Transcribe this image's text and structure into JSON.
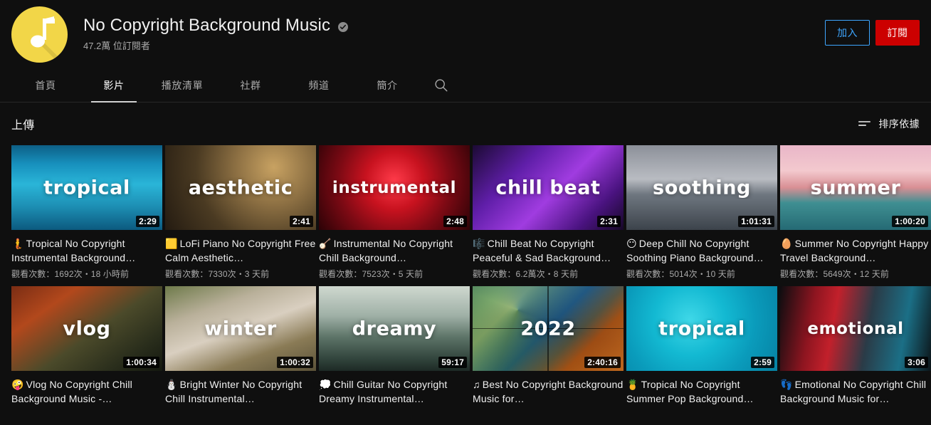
{
  "channel": {
    "avatar_icon": "music-note-icon",
    "avatar_color": "#f2d648",
    "title": "No Copyright Background Music",
    "verified_icon": "verified-check-icon",
    "subscribers": "47.2萬 位訂閱者",
    "join_label": "加入",
    "subscribe_label": "訂閱",
    "join_color": "#3ea6ff",
    "subscribe_color": "#cc0000"
  },
  "tabs": [
    {
      "label": "首頁",
      "active": false
    },
    {
      "label": "影片",
      "active": true
    },
    {
      "label": "播放清單",
      "active": false
    },
    {
      "label": "社群",
      "active": false
    },
    {
      "label": "頻道",
      "active": false
    },
    {
      "label": "簡介",
      "active": false
    }
  ],
  "search_icon": "search-icon",
  "section": {
    "title": "上傳",
    "sort_label": "排序依據",
    "sort_icon": "sort-lines-icon"
  },
  "videos": [
    {
      "emoji": "🧜",
      "emoji_name": "merperson-icon",
      "title": "Tropical No Copyright Instrumental Background…",
      "meta": "觀看次數：1692次・18 小時前",
      "duration": "2:29",
      "thumb_word": "tropical",
      "thumb_style": "underwater-blue"
    },
    {
      "emoji": "🟨",
      "emoji_name": "yellow-square-icon",
      "title": "LoFi Piano No Copyright Free Calm Aesthetic…",
      "meta": "觀看次數：7330次・3 天前",
      "duration": "2:41",
      "thumb_word": "aesthetic",
      "thumb_style": "piano-brown"
    },
    {
      "emoji": "🪕",
      "emoji_name": "banjo-icon",
      "title": "Instrumental No Copyright Chill Background…",
      "meta": "觀看次數：7523次・5 天前",
      "duration": "2:48",
      "thumb_word": "instrumental",
      "thumb_style": "neon-red"
    },
    {
      "emoji": "🎼",
      "emoji_name": "musical-score-icon",
      "title": "Chill Beat No Copyright Peaceful & Sad Background…",
      "meta": "觀看次數：6.2萬次・8 天前",
      "duration": "2:31",
      "thumb_word": "chill beat",
      "thumb_style": "dj-purple"
    },
    {
      "emoji": "😶",
      "emoji_name": "gray-face-icon",
      "title": "Deep Chill No Copyright Soothing Piano Background…",
      "meta": "觀看次數：5014次・10 天前",
      "duration": "1:01:31",
      "thumb_word": "soothing",
      "thumb_style": "sea-gray"
    },
    {
      "emoji": "🥚",
      "emoji_name": "egg-icon",
      "title": "Summer No Copyright Happy Travel Background…",
      "meta": "觀看次數：5649次・12 天前",
      "duration": "1:00:20",
      "thumb_word": "summer",
      "thumb_style": "sunset-pink"
    },
    {
      "emoji": "🤪",
      "emoji_name": "zany-face-icon",
      "title": "Vlog No Copyright Chill Background Music -…",
      "meta": "",
      "duration": "1:00:34",
      "thumb_word": "vlog",
      "thumb_style": "autumn-camera"
    },
    {
      "emoji": "⛄",
      "emoji_name": "snowman-icon",
      "title": "Bright Winter No Copyright Chill Instrumental…",
      "meta": "",
      "duration": "1:00:32",
      "thumb_word": "winter",
      "thumb_style": "snow-leaves"
    },
    {
      "emoji": "💭",
      "emoji_name": "thought-balloon-icon",
      "title": "Chill Guitar No Copyright Dreamy Instrumental…",
      "meta": "",
      "duration": "59:17",
      "thumb_word": "dreamy",
      "thumb_style": "boat-misty"
    },
    {
      "emoji": "♫",
      "emoji_name": "music-notes-icon",
      "title": "Best No Copyright Background Music for…",
      "meta": "",
      "duration": "2:40:16",
      "thumb_word": "2022",
      "thumb_style": "collage-2022"
    },
    {
      "emoji": "🍍",
      "emoji_name": "pineapple-icon",
      "title": "Tropical No Copyright Summer Pop Background…",
      "meta": "",
      "duration": "2:59",
      "thumb_word": "tropical",
      "thumb_style": "pool-cyan"
    },
    {
      "emoji": "👣",
      "emoji_name": "footprints-icon",
      "title": "Emotional No Copyright Chill Background Music for…",
      "meta": "",
      "duration": "3:06",
      "thumb_word": "emotional",
      "thumb_style": "portrait-redblue"
    }
  ]
}
